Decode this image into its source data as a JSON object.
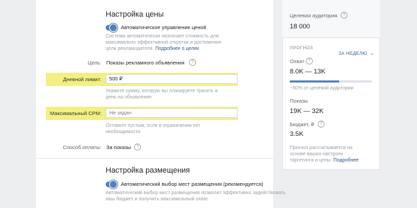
{
  "price": {
    "title": "Настройка цены",
    "auto_toggle_label": "Автоматическое управление ценой",
    "auto_desc_lines": [
      "Система автоматически назначает стоимость для",
      "максимально эффективной открутки и достижения"
    ],
    "auto_desc_last": "цели рекламодателя.",
    "more_link": "Подробнее о целях",
    "goal_label": "Цель:",
    "goal_value": "Показы рекламного объявления",
    "daily_label": "Дневной лимит:",
    "daily_value": "500 ₽",
    "daily_hint_lines": [
      "Укажите сумму, которую вы планируете тратить в",
      "день на объявление"
    ],
    "cpm_label": "Максимальный CPM:",
    "cpm_value": "Не задан",
    "cpm_hint_lines": [
      "Оставьте пустым, если в ограничении нет",
      "необходимости"
    ],
    "payment_label": "Способ оплаты:",
    "payment_value": "За показы"
  },
  "placement": {
    "title": "Настройка размещения",
    "auto_toggle_label": "Автоматический выбор мест размещения (рекомендуется)",
    "desc_lines": [
      "Автоматический выбор мест размещения позволит эффективно задействовать",
      "ваш бюджет и получить максимальный охват."
    ]
  },
  "forecast": {
    "audience_label": "Целевая аудитория",
    "audience_value": "18 000",
    "forecast_label": "ПРОГНОЗ",
    "period": "ЗА НЕДЕЛЮ",
    "reach_label": "Охват",
    "reach_value": "8.0K — 13K",
    "reach_fill_fraction": 0.6,
    "reach_note": "~60% от целевой аудитории",
    "impressions_label": "Показы",
    "impressions_value": "19K — 32K",
    "budget_label": "Бюджет, ₽",
    "budget_value": "3.5K",
    "note_lines": [
      "Прогноз рассчитывается на",
      "основе ваших настроек"
    ],
    "note_last": "таргетинга и цены.",
    "note_link": "Подробнее"
  },
  "colors": {
    "accent": "#5181b8",
    "highlight": "#f4ef82",
    "link": "#2a5885"
  }
}
